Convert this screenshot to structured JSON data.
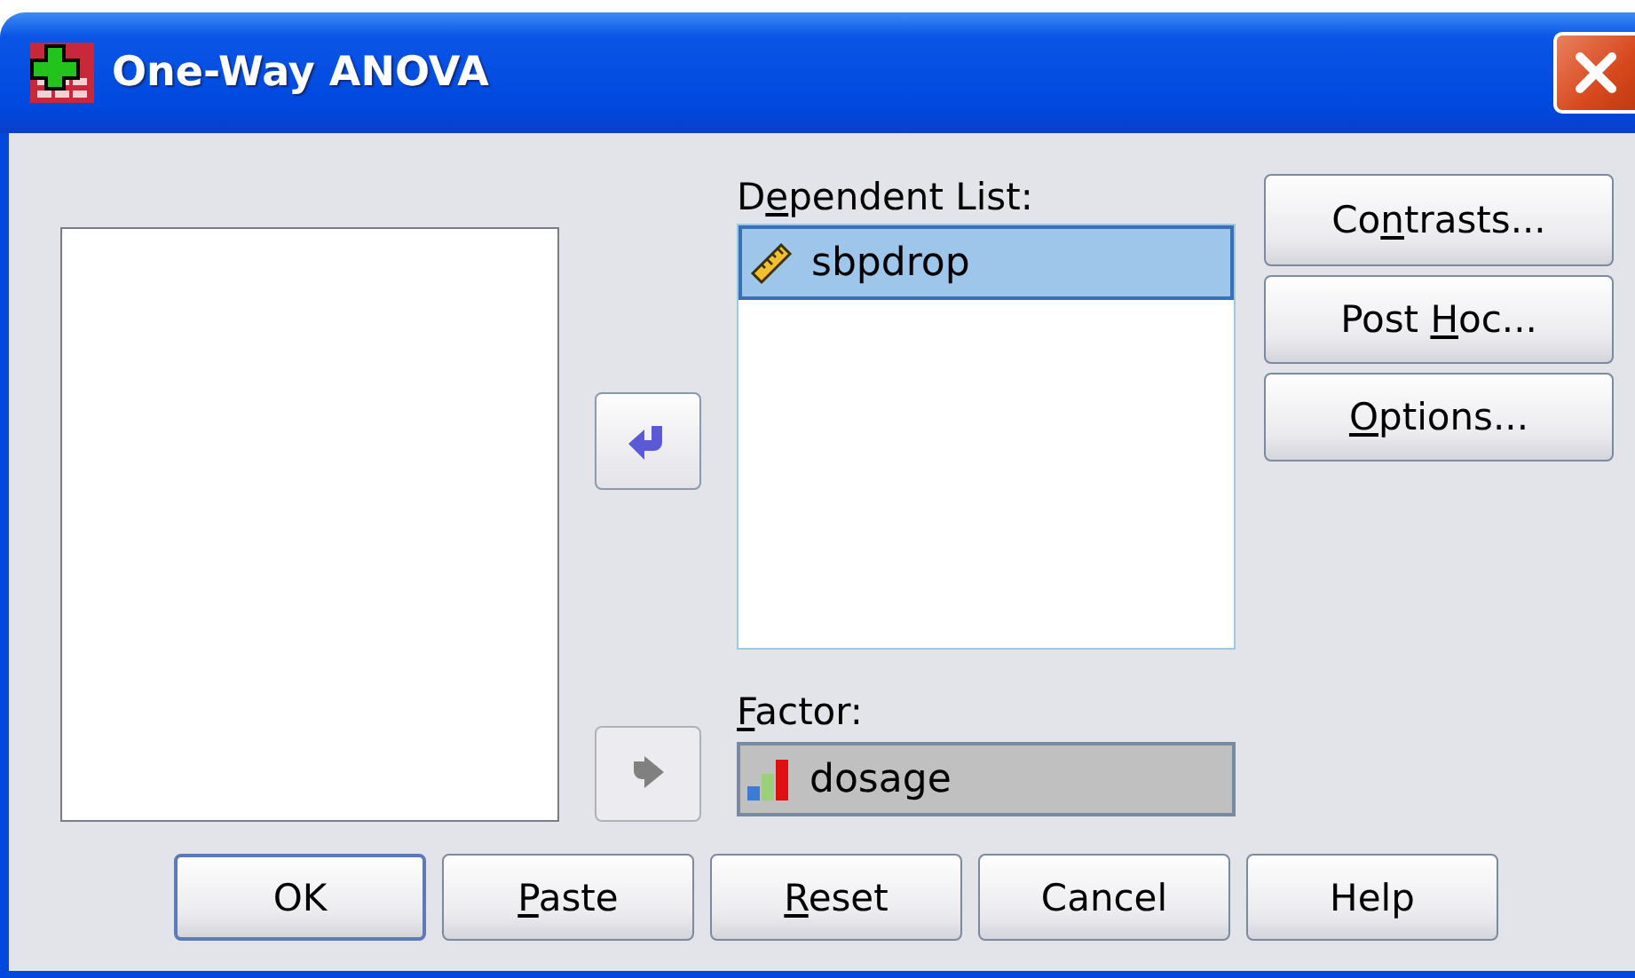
{
  "window": {
    "title": "One-Way ANOVA"
  },
  "move_buttons": [
    {
      "kind": "left",
      "disabled": false
    },
    {
      "kind": "right",
      "disabled": true
    }
  ],
  "dependent_list": {
    "label_start": "D",
    "mnemonic": "e",
    "label_end": "pendent List:",
    "items": [
      {
        "name": "sbpdrop",
        "kind": "scale",
        "selected": true
      }
    ]
  },
  "factor": {
    "mnemonic": "F",
    "label_end": "actor:",
    "name": "dosage",
    "kind": "ordinal"
  },
  "side_buttons": [
    {
      "label_start": "Co",
      "mnemonic": "n",
      "label_end": "trasts..."
    },
    {
      "label_start": "Post ",
      "mnemonic": "H",
      "label_end": "oc..."
    },
    {
      "mnemonic": "O",
      "label_end": "ptions..."
    }
  ],
  "buttons": [
    {
      "label_end": "OK",
      "default": true
    },
    {
      "mnemonic": "P",
      "label_end": "aste",
      "default": false
    },
    {
      "mnemonic": "R",
      "label_end": "eset",
      "default": false
    },
    {
      "label_end": "Cancel",
      "default": false
    },
    {
      "label_end": "Help",
      "default": false
    }
  ]
}
